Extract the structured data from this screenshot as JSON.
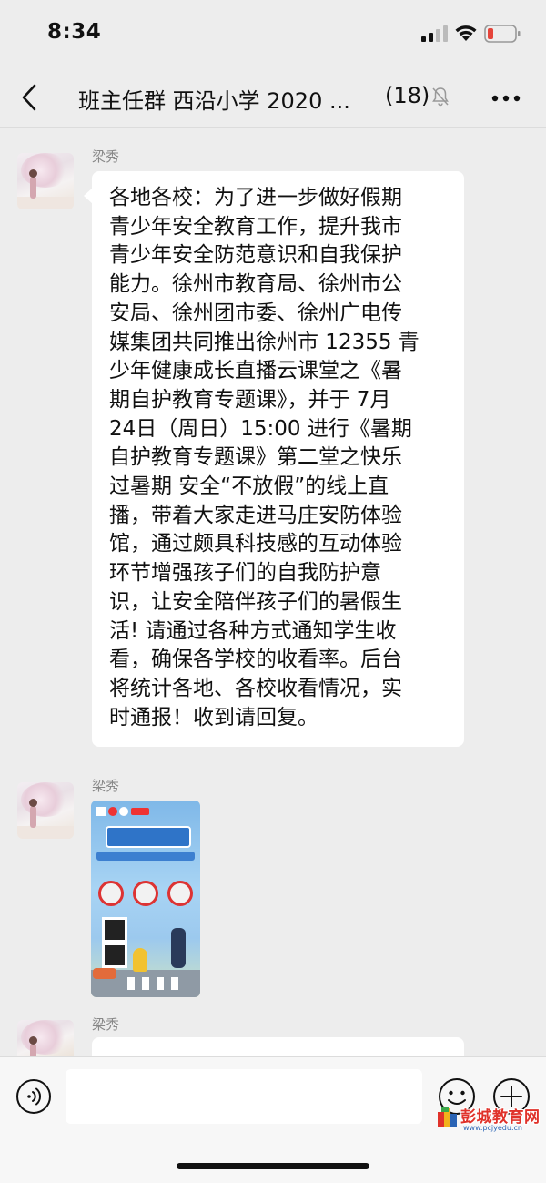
{
  "status_bar": {
    "time": "8:34"
  },
  "nav": {
    "title": "班主任群 西沿小学 2020 ...",
    "member_count": "(18)"
  },
  "messages": [
    {
      "sender": "梁秀",
      "type": "text",
      "text": "各地各校：为了进一步做好假期\n青少年安全教育工作，提升我市\n青少年安全防范意识和自我保护\n能力。徐州市教育局、徐州市公\n安局、徐州团市委、徐州广电传\n媒集团共同推出徐州市 12355 青\n少年健康成长直播云课堂之《暑\n期自护教育专题课》，并于 7月\n24日（周日）15:00 进行《暑期\n自护教育专题课》第二堂之快乐\n过暑期 安全“不放假”的线上直\n播，带着大家走进马庄安防体验\n馆，通过颇具科技感的互动体验\n环节增强孩子们的自我防护意\n识，让安全陪伴孩子们的暑假生\n活! 请通过各种方式通知学生收\n看，确保各学校的收看率。后台\n将统计各地、各校收看情况，实\n时通报！收到请回复。"
    },
    {
      "sender": "梁秀",
      "type": "image"
    },
    {
      "sender": "梁秀",
      "type": "text-partial"
    }
  ],
  "input_bar": {
    "placeholder": ""
  },
  "watermark": {
    "name": "彭城教育网",
    "url": "www.pcjyedu.cn"
  },
  "icons": {
    "back": "chevron-left-icon",
    "mute": "bell-muted-icon",
    "more": "more-dots-icon",
    "voice": "voice-icon",
    "emoji": "emoji-icon",
    "plus": "plus-icon"
  },
  "colors": {
    "background": "#ededed",
    "bubble": "#ffffff",
    "battery_low": "#e5443a",
    "watermark_red": "#e0322a"
  }
}
